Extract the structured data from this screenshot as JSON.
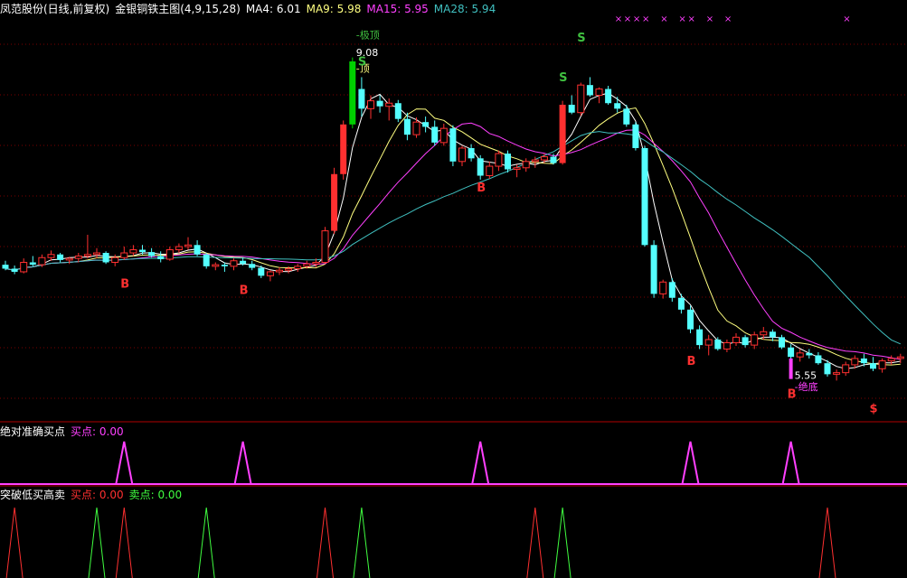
{
  "header": {
    "title": "凤范股份(日线,前复权)",
    "indicator_name": "金银铜铁主图(4,9,15,28)",
    "ma_labels": [
      {
        "text": "MA4: 6.01",
        "color": "#ffffff"
      },
      {
        "text": "MA9: 5.98",
        "color": "#ffff80"
      },
      {
        "text": "MA15: 5.95",
        "color": "#ff40ff"
      },
      {
        "text": "MA28: 5.94",
        "color": "#40c0c0"
      }
    ]
  },
  "panel2": {
    "title": "绝对准确买点",
    "labels": [
      {
        "text": "买点: 0.00",
        "color": "#ff40ff"
      }
    ]
  },
  "panel3": {
    "title": "突破低买高卖",
    "labels": [
      {
        "text": "买点: 0.00",
        "color": "#ff3030"
      },
      {
        "text": "卖点: 0.00",
        "color": "#40ff40"
      }
    ]
  },
  "chart_data": {
    "type": "candlestick",
    "ylim": [
      4.5,
      9.6
    ],
    "colors": {
      "up": "#ff3030",
      "down": "#54ffff",
      "signal_top": "#00d000",
      "signal_bottom": "#ff40ff",
      "buy_marker": "#ff3030",
      "sell_marker": "#40c040"
    },
    "candles": [
      [
        6.47,
        6.52,
        6.4,
        6.42
      ],
      [
        6.42,
        6.46,
        6.35,
        6.38
      ],
      [
        6.38,
        6.55,
        6.36,
        6.5
      ],
      [
        6.5,
        6.58,
        6.45,
        6.47
      ],
      [
        6.47,
        6.6,
        6.44,
        6.56
      ],
      [
        6.56,
        6.65,
        6.52,
        6.6
      ],
      [
        6.6,
        6.62,
        6.5,
        6.53
      ],
      [
        6.53,
        6.57,
        6.48,
        6.55
      ],
      [
        6.55,
        6.62,
        6.5,
        6.58
      ],
      [
        6.58,
        6.85,
        6.55,
        6.6
      ],
      [
        6.6,
        6.68,
        6.55,
        6.62
      ],
      [
        6.62,
        6.64,
        6.48,
        6.5
      ],
      [
        6.5,
        6.6,
        6.45,
        6.56
      ],
      [
        6.56,
        6.7,
        6.53,
        6.62
      ],
      [
        6.62,
        6.72,
        6.58,
        6.66
      ],
      [
        6.66,
        6.72,
        6.6,
        6.63
      ],
      [
        6.63,
        6.68,
        6.56,
        6.58
      ],
      [
        6.58,
        6.64,
        6.5,
        6.54
      ],
      [
        6.54,
        6.7,
        6.52,
        6.66
      ],
      [
        6.66,
        6.74,
        6.62,
        6.7
      ],
      [
        6.7,
        6.82,
        6.66,
        6.72
      ],
      [
        6.72,
        6.78,
        6.58,
        6.6
      ],
      [
        6.6,
        6.62,
        6.42,
        6.45
      ],
      [
        6.45,
        6.5,
        6.4,
        6.47
      ],
      [
        6.47,
        6.5,
        6.38,
        6.45
      ],
      [
        6.45,
        6.55,
        6.4,
        6.52
      ],
      [
        6.52,
        6.56,
        6.46,
        6.48
      ],
      [
        6.48,
        6.52,
        6.4,
        6.43
      ],
      [
        6.43,
        6.46,
        6.3,
        6.33
      ],
      [
        6.33,
        6.4,
        6.26,
        6.38
      ],
      [
        6.38,
        6.44,
        6.34,
        6.4
      ],
      [
        6.4,
        6.45,
        6.36,
        6.42
      ],
      [
        6.42,
        6.48,
        6.38,
        6.45
      ],
      [
        6.45,
        6.52,
        6.42,
        6.48
      ],
      [
        6.48,
        6.55,
        6.44,
        6.5
      ],
      [
        6.5,
        6.95,
        6.48,
        6.9
      ],
      [
        6.9,
        7.7,
        6.86,
        7.62
      ],
      [
        7.62,
        8.3,
        7.55,
        8.25
      ],
      [
        8.25,
        9.1,
        8.2,
        9.05
      ],
      [
        8.7,
        8.85,
        8.35,
        8.45
      ],
      [
        8.45,
        8.62,
        8.32,
        8.55
      ],
      [
        8.55,
        8.62,
        8.4,
        8.48
      ],
      [
        8.48,
        8.58,
        8.3,
        8.52
      ],
      [
        8.52,
        8.56,
        8.28,
        8.32
      ],
      [
        8.32,
        8.4,
        8.05,
        8.12
      ],
      [
        8.12,
        8.34,
        8.08,
        8.28
      ],
      [
        8.28,
        8.35,
        8.15,
        8.22
      ],
      [
        8.22,
        8.3,
        7.98,
        8.02
      ],
      [
        8.02,
        8.26,
        7.98,
        8.2
      ],
      [
        8.2,
        8.24,
        7.72,
        7.78
      ],
      [
        7.78,
        7.98,
        7.72,
        7.95
      ],
      [
        7.95,
        8.0,
        7.78,
        7.82
      ],
      [
        7.82,
        7.86,
        7.55,
        7.6
      ],
      [
        7.6,
        7.78,
        7.56,
        7.72
      ],
      [
        7.72,
        7.92,
        7.66,
        7.88
      ],
      [
        7.88,
        7.92,
        7.64,
        7.68
      ],
      [
        7.68,
        7.74,
        7.58,
        7.7
      ],
      [
        7.7,
        7.82,
        7.65,
        7.78
      ],
      [
        7.78,
        7.84,
        7.7,
        7.8
      ],
      [
        7.8,
        7.88,
        7.76,
        7.84
      ],
      [
        7.84,
        7.88,
        7.74,
        7.76
      ],
      [
        7.76,
        8.55,
        7.74,
        8.5
      ],
      [
        8.5,
        8.62,
        8.38,
        8.4
      ],
      [
        8.4,
        8.78,
        8.36,
        8.75
      ],
      [
        8.75,
        8.85,
        8.6,
        8.62
      ],
      [
        8.62,
        8.72,
        8.52,
        8.7
      ],
      [
        8.7,
        8.74,
        8.5,
        8.52
      ],
      [
        8.52,
        8.6,
        8.4,
        8.45
      ],
      [
        8.45,
        8.5,
        8.22,
        8.25
      ],
      [
        8.25,
        8.28,
        7.92,
        7.95
      ],
      [
        7.95,
        7.98,
        6.7,
        6.72
      ],
      [
        6.72,
        6.78,
        6.05,
        6.1
      ],
      [
        6.1,
        6.28,
        6.04,
        6.25
      ],
      [
        6.25,
        6.3,
        6.0,
        6.05
      ],
      [
        6.05,
        6.1,
        5.85,
        5.9
      ],
      [
        5.9,
        5.95,
        5.6,
        5.65
      ],
      [
        5.65,
        5.7,
        5.4,
        5.45
      ],
      [
        5.45,
        5.58,
        5.32,
        5.52
      ],
      [
        5.52,
        5.55,
        5.38,
        5.4
      ],
      [
        5.4,
        5.52,
        5.36,
        5.48
      ],
      [
        5.48,
        5.6,
        5.44,
        5.55
      ],
      [
        5.55,
        5.58,
        5.42,
        5.45
      ],
      [
        5.45,
        5.62,
        5.4,
        5.58
      ],
      [
        5.58,
        5.68,
        5.52,
        5.62
      ],
      [
        5.62,
        5.65,
        5.5,
        5.55
      ],
      [
        5.55,
        5.58,
        5.4,
        5.42
      ],
      [
        5.42,
        5.46,
        5.26,
        5.3
      ],
      [
        5.3,
        5.4,
        5.24,
        5.35
      ],
      [
        5.35,
        5.4,
        5.28,
        5.32
      ],
      [
        5.32,
        5.36,
        5.2,
        5.22
      ],
      [
        5.22,
        5.26,
        5.05,
        5.08
      ],
      [
        5.08,
        5.14,
        5.0,
        5.1
      ],
      [
        5.1,
        5.24,
        5.06,
        5.2
      ],
      [
        5.2,
        5.32,
        5.15,
        5.28
      ],
      [
        5.28,
        5.34,
        5.18,
        5.22
      ],
      [
        5.22,
        5.3,
        5.12,
        5.15
      ],
      [
        5.15,
        5.28,
        5.1,
        5.25
      ],
      [
        5.25,
        5.32,
        5.2,
        5.28
      ],
      [
        5.28,
        5.34,
        5.22,
        5.3
      ]
    ],
    "annotations": [
      {
        "text": "-极顶",
        "index": 38,
        "price": 9.34,
        "color": "#40c040"
      },
      {
        "text": "9.08",
        "index": 38,
        "price": 9.12,
        "color": "#ffffff"
      },
      {
        "text": "-顶",
        "index": 38,
        "price": 8.92,
        "color": "#ffff80"
      },
      {
        "text": "5.55",
        "index": 86,
        "price": 5.02,
        "color": "#ffffff"
      },
      {
        "text": "-绝底",
        "index": 86,
        "price": 4.88,
        "color": "#ff40ff"
      }
    ],
    "sell_markers": [
      {
        "text": "S",
        "index": 39,
        "price": 9.0
      },
      {
        "text": "S",
        "index": 61,
        "price": 8.8
      },
      {
        "text": "S",
        "index": 63,
        "price": 9.3
      }
    ],
    "buy_markers": [
      {
        "text": "B",
        "index": 13,
        "price": 6.18
      },
      {
        "text": "B",
        "index": 26,
        "price": 6.1
      },
      {
        "text": "B",
        "index": 52,
        "price": 7.4
      },
      {
        "text": "B",
        "index": 75,
        "price": 5.2
      },
      {
        "text": "B",
        "index": 86,
        "price": 4.78
      },
      {
        "text": "$",
        "index": 95,
        "price": 4.6
      }
    ],
    "top_x_marks": [
      67,
      68,
      69,
      70,
      72,
      74,
      75,
      77,
      79,
      92
    ],
    "panel2_buy_spikes": [
      13,
      26,
      52,
      75,
      86
    ],
    "panel3_buy_spikes": [
      1,
      13,
      35,
      58,
      90
    ],
    "panel3_sell_spikes": [
      10,
      22,
      39,
      61
    ]
  }
}
